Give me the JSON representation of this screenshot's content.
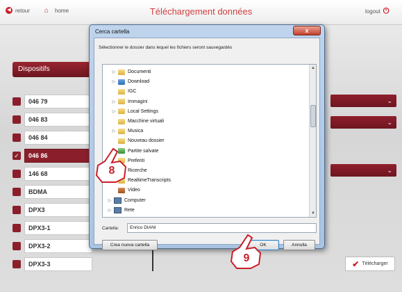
{
  "header": {
    "back_label": "retour",
    "home_label": "home",
    "title": "Téléchargement données",
    "logout_label": "logout"
  },
  "sidebar": {
    "section_title": "Dispositifs",
    "items": [
      {
        "label": "046 79",
        "checked": false
      },
      {
        "label": "046 83",
        "checked": false
      },
      {
        "label": "046 84",
        "checked": false
      },
      {
        "label": "046 86",
        "checked": true
      },
      {
        "label": "146 68",
        "checked": false
      },
      {
        "label": "BDMA",
        "checked": false
      },
      {
        "label": "DPX3",
        "checked": false
      },
      {
        "label": "DPX3-1",
        "checked": false
      },
      {
        "label": "DPX3-2",
        "checked": false
      },
      {
        "label": "DPX3-3",
        "checked": false
      }
    ]
  },
  "right_panel": {
    "download_button": "Télécharger"
  },
  "dialog": {
    "title": "Cerca cartella",
    "close_label": "x",
    "instruction": "Sélectionner le dossier dans lequel les fichiers seront sauvegardés",
    "tree": [
      {
        "label": "Documenti",
        "icon": "folder-documents-icon",
        "expander": "▷"
      },
      {
        "label": "Download",
        "icon": "folder-download-icon",
        "expander": "▷"
      },
      {
        "label": "IGC",
        "icon": "folder-icon",
        "expander": ""
      },
      {
        "label": "Immagini",
        "icon": "folder-pictures-icon",
        "expander": "▷"
      },
      {
        "label": "Local Settings",
        "icon": "folder-icon",
        "expander": "▷"
      },
      {
        "label": "Macchine virtuali",
        "icon": "folder-icon",
        "expander": ""
      },
      {
        "label": "Musica",
        "icon": "folder-music-icon",
        "expander": "▷"
      },
      {
        "label": "Nouveau dossier",
        "icon": "folder-icon",
        "expander": ""
      },
      {
        "label": "Partite salvate",
        "icon": "folder-games-icon",
        "expander": ""
      },
      {
        "label": "Preferiti",
        "icon": "folder-favorites-icon",
        "expander": ""
      },
      {
        "label": "Ricerche",
        "icon": "folder-icon",
        "expander": ""
      },
      {
        "label": "RealtimeTranscripts",
        "icon": "folder-icon",
        "expander": ""
      },
      {
        "label": "Video",
        "icon": "folder-videos-icon",
        "expander": ""
      },
      {
        "label": "Computer",
        "icon": "computer-icon",
        "expander": "▷"
      },
      {
        "label": "Rete",
        "icon": "network-icon",
        "expander": "▷"
      }
    ],
    "folder_label": "Cartella:",
    "folder_value": "Enrico DIANI",
    "new_folder_button": "Crea nuova cartella",
    "ok_button": "OK",
    "cancel_button": "Annulla"
  },
  "callouts": [
    {
      "number": "8"
    },
    {
      "number": "9"
    }
  ],
  "colors": {
    "accent": "#8a1f2b",
    "title_red": "#d04040"
  }
}
